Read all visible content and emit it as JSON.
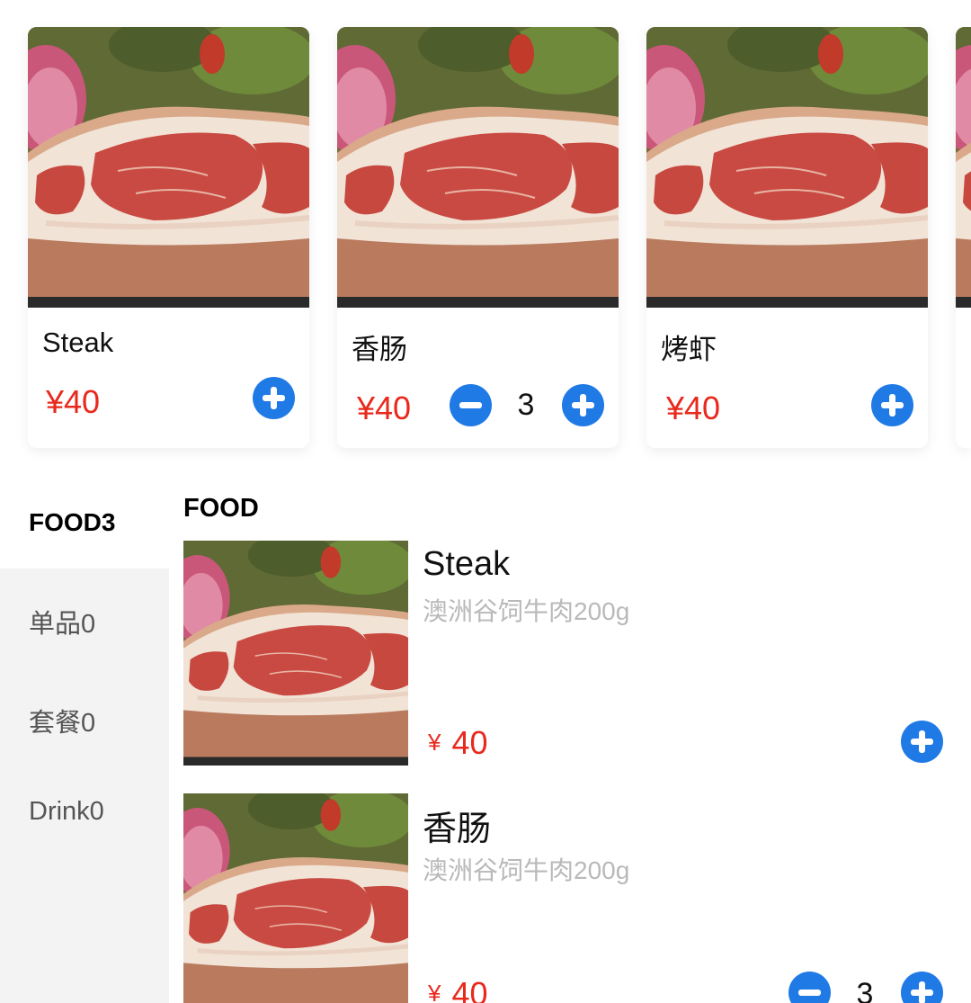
{
  "top_cards": [
    {
      "name": "Steak",
      "price": "¥40",
      "quantity": null
    },
    {
      "name": "香肠",
      "price": "¥40",
      "quantity": "3"
    },
    {
      "name": "烤虾",
      "price": "¥40",
      "quantity": null
    }
  ],
  "sidebar": {
    "items": [
      {
        "label": "FOOD3",
        "active": true
      },
      {
        "label": "单品0",
        "active": false
      },
      {
        "label": "套餐0",
        "active": false
      },
      {
        "label": "Drink0",
        "active": false
      }
    ]
  },
  "section": {
    "title": "FOOD"
  },
  "list_items": [
    {
      "name": "Steak",
      "description": "澳洲谷饲牛肉200g",
      "currency": "¥",
      "price": "40",
      "quantity": null
    },
    {
      "name": "香肠",
      "description": "澳洲谷饲牛肉200g",
      "currency": "¥",
      "price": "40",
      "quantity": "3"
    }
  ],
  "icons": {
    "add": "plus-circle-icon",
    "remove": "minus-circle-icon"
  },
  "colors": {
    "price": "#e8291c",
    "accent": "#1f7ae6",
    "sidebar_bg": "#f3f3f3",
    "muted_text": "#b9b9b9"
  }
}
